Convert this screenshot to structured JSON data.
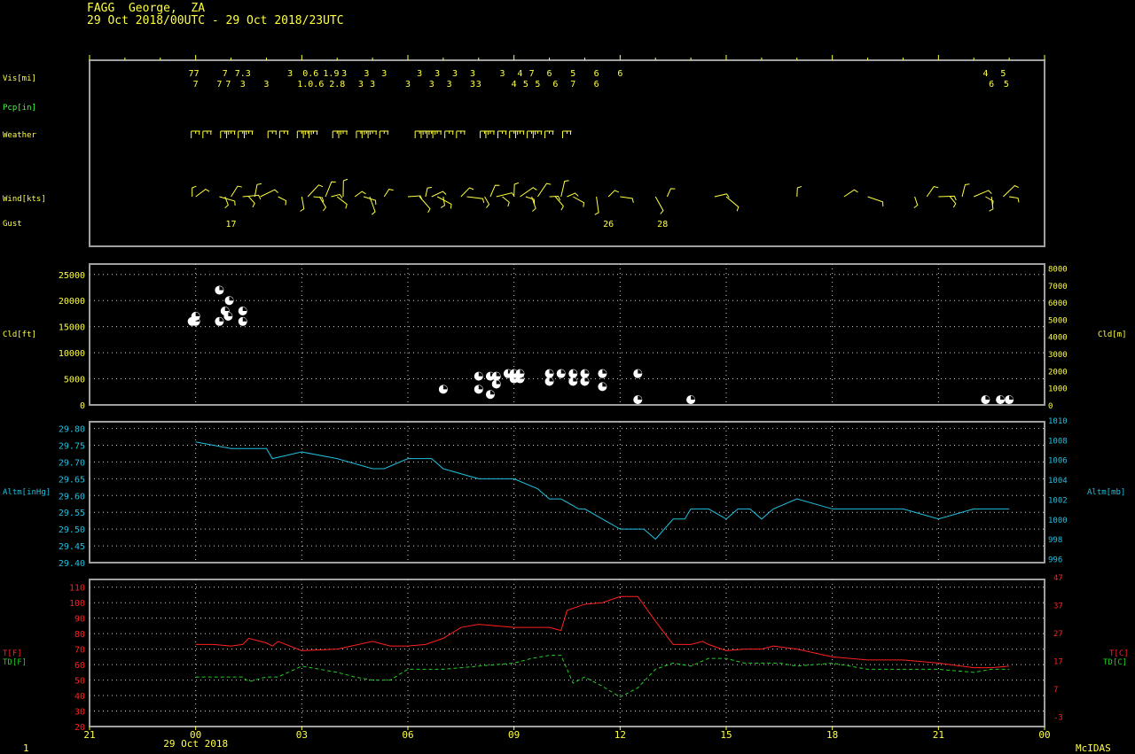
{
  "header": {
    "station_line": "FAGG  George,  ZA",
    "period_line": "29 Oct 2018/00UTC - 29 Oct 2018/23UTC"
  },
  "footer": {
    "left_label": "1",
    "brand": "McIDAS"
  },
  "colors": {
    "frame": "#a0a0a0",
    "labels": "#ffff40",
    "pcp": "#40ff40",
    "altimeter": "#20c0e0",
    "temp": "#ff2020",
    "dewpoint": "#20d020",
    "grid": "#d0d0d0"
  },
  "chart_data": [
    {
      "type": "table",
      "panel": "station-plot",
      "rows": [
        "Vis[mi]",
        "Pcp[in]",
        "Weather",
        "Wind[kts]",
        "Gust"
      ],
      "visibility": [
        {
          "t": -0.05,
          "v": "77",
          "level": 1
        },
        {
          "t": 0.0,
          "v": "7",
          "level": 2
        },
        {
          "t": 0.83,
          "v": "7",
          "level": 1
        },
        {
          "t": 0.67,
          "v": "7",
          "level": 2
        },
        {
          "t": 0.92,
          "v": "7",
          "level": 2
        },
        {
          "t": 1.33,
          "v": "7.3",
          "level": 1
        },
        {
          "t": 1.33,
          "v": "3",
          "level": 2
        },
        {
          "t": 2.0,
          "v": "3",
          "level": 2
        },
        {
          "t": 2.67,
          "v": "3",
          "level": 1
        },
        {
          "t": 3.25,
          "v": "0.6",
          "level": 1
        },
        {
          "t": 3.25,
          "v": "1.0.6",
          "level": 2
        },
        {
          "t": 3.83,
          "v": "1.9",
          "level": 1
        },
        {
          "t": 4.2,
          "v": "3",
          "level": 1
        },
        {
          "t": 4.0,
          "v": "2.8",
          "level": 2
        },
        {
          "t": 4.83,
          "v": "3",
          "level": 1
        },
        {
          "t": 5.33,
          "v": "3",
          "level": 1
        },
        {
          "t": 4.67,
          "v": "3",
          "level": 2
        },
        {
          "t": 5.0,
          "v": "3",
          "level": 2
        },
        {
          "t": 6.0,
          "v": "3",
          "level": 2
        },
        {
          "t": 6.33,
          "v": "3",
          "level": 1
        },
        {
          "t": 6.67,
          "v": "3",
          "level": 2
        },
        {
          "t": 6.83,
          "v": "3",
          "level": 1
        },
        {
          "t": 7.33,
          "v": "3",
          "level": 1
        },
        {
          "t": 7.17,
          "v": "3",
          "level": 2
        },
        {
          "t": 7.83,
          "v": "3",
          "level": 1
        },
        {
          "t": 7.83,
          "v": "3",
          "level": 2
        },
        {
          "t": 8.0,
          "v": "3",
          "level": 2
        },
        {
          "t": 8.67,
          "v": "3",
          "level": 1
        },
        {
          "t": 9.0,
          "v": "4",
          "level": 2
        },
        {
          "t": 9.17,
          "v": "4",
          "level": 1
        },
        {
          "t": 9.33,
          "v": "5",
          "level": 2
        },
        {
          "t": 9.5,
          "v": "7",
          "level": 1
        },
        {
          "t": 9.67,
          "v": "5",
          "level": 2
        },
        {
          "t": 10.0,
          "v": "6",
          "level": 1
        },
        {
          "t": 10.17,
          "v": "6",
          "level": 2
        },
        {
          "t": 10.67,
          "v": "5",
          "level": 1
        },
        {
          "t": 10.67,
          "v": "7",
          "level": 2
        },
        {
          "t": 11.33,
          "v": "6",
          "level": 1
        },
        {
          "t": 11.33,
          "v": "6",
          "level": 2
        },
        {
          "t": 12.0,
          "v": "6",
          "level": 1
        },
        {
          "t": 22.33,
          "v": "4",
          "level": 1
        },
        {
          "t": 22.5,
          "v": "6",
          "level": 2
        },
        {
          "t": 22.83,
          "v": "5",
          "level": 1
        },
        {
          "t": 22.92,
          "v": "5",
          "level": 2
        }
      ],
      "gust_kts": [
        {
          "t": 1.0,
          "v": "17"
        },
        {
          "t": 11.67,
          "v": "26"
        },
        {
          "t": 13.2,
          "v": "28"
        }
      ],
      "wind_barbs_t": [
        -0.1,
        0.0,
        0.67,
        0.83,
        1.0,
        1.33,
        1.5,
        1.67,
        1.83,
        2.33,
        3.0,
        3.17,
        3.33,
        3.5,
        3.67,
        3.83,
        4.0,
        4.17,
        4.5,
        4.75,
        4.92,
        5.33,
        6.0,
        6.33,
        6.5,
        6.67,
        6.83,
        7.0,
        7.5,
        7.67,
        8.17,
        8.33,
        8.5,
        8.67,
        9.0,
        9.17,
        9.33,
        9.5,
        9.67,
        10.0,
        10.17,
        10.33,
        10.5,
        10.67,
        11.33,
        11.67,
        12.0,
        13.0,
        13.33,
        14.67,
        15.0,
        17.0,
        18.33,
        19.0,
        20.33,
        20.67,
        21.0,
        21.33,
        21.67,
        22.0,
        22.33,
        22.5,
        22.83,
        23.0
      ],
      "weather_t": [
        0.0,
        0.33,
        0.83,
        1.0,
        1.33,
        1.5,
        2.17,
        2.5,
        3.0,
        3.17,
        3.33,
        4.0,
        4.17,
        4.67,
        4.83,
        5.0,
        5.33,
        6.33,
        6.5,
        6.67,
        6.83,
        7.17,
        7.5,
        8.17,
        8.33,
        8.67,
        9.0,
        9.17,
        9.5,
        9.67,
        10.0,
        10.5
      ]
    },
    {
      "type": "scatter",
      "panel": "cloud-base",
      "ylabel": "Cld[ft]",
      "ylabel_right": "Cld[m]",
      "ylim": [
        0,
        27000
      ],
      "y_ticks": [
        0,
        5000,
        10000,
        15000,
        20000,
        25000
      ],
      "y2_ticks": [
        0,
        1000,
        2000,
        3000,
        4000,
        5000,
        6000,
        7000,
        8000
      ],
      "points": [
        {
          "t": -0.1,
          "ft": 16000
        },
        {
          "t": 0.0,
          "ft": 16000
        },
        {
          "t": 0.0,
          "ft": 17000
        },
        {
          "t": 0.67,
          "ft": 22000
        },
        {
          "t": 0.67,
          "ft": 16000
        },
        {
          "t": 0.83,
          "ft": 18000
        },
        {
          "t": 0.92,
          "ft": 17000
        },
        {
          "t": 0.95,
          "ft": 20000
        },
        {
          "t": 1.33,
          "ft": 18000
        },
        {
          "t": 1.33,
          "ft": 16000
        },
        {
          "t": 7.0,
          "ft": 3000
        },
        {
          "t": 8.0,
          "ft": 5500
        },
        {
          "t": 8.0,
          "ft": 3000
        },
        {
          "t": 8.33,
          "ft": 5500
        },
        {
          "t": 8.33,
          "ft": 2000
        },
        {
          "t": 8.5,
          "ft": 4000
        },
        {
          "t": 8.5,
          "ft": 5500
        },
        {
          "t": 8.83,
          "ft": 6000
        },
        {
          "t": 9.0,
          "ft": 5000
        },
        {
          "t": 9.0,
          "ft": 6000
        },
        {
          "t": 9.17,
          "ft": 5000
        },
        {
          "t": 9.17,
          "ft": 6000
        },
        {
          "t": 10.0,
          "ft": 4500
        },
        {
          "t": 10.0,
          "ft": 6000
        },
        {
          "t": 10.33,
          "ft": 6000
        },
        {
          "t": 10.67,
          "ft": 4500
        },
        {
          "t": 10.67,
          "ft": 6000
        },
        {
          "t": 11.0,
          "ft": 4500
        },
        {
          "t": 11.0,
          "ft": 6000
        },
        {
          "t": 11.5,
          "ft": 3500
        },
        {
          "t": 11.5,
          "ft": 6000
        },
        {
          "t": 12.5,
          "ft": 6000
        },
        {
          "t": 12.5,
          "ft": 1000
        },
        {
          "t": 14.0,
          "ft": 1000
        },
        {
          "t": 22.33,
          "ft": 1000
        },
        {
          "t": 22.75,
          "ft": 1000
        },
        {
          "t": 23.0,
          "ft": 1000
        }
      ]
    },
    {
      "type": "line",
      "panel": "altimeter",
      "ylabel": "Altm[inHg]",
      "ylabel_right": "Altm[mb]",
      "ylim": [
        29.4,
        29.82
      ],
      "y_ticks": [
        "29.40",
        "29.45",
        "29.50",
        "29.55",
        "29.60",
        "29.65",
        "29.70",
        "29.75",
        "29.80"
      ],
      "y2_ticks": [
        "996",
        "998",
        "1000",
        "1002",
        "1004",
        "1006",
        "1008",
        "1010"
      ],
      "series": [
        {
          "color": "#20c0e0",
          "x": [
            0.0,
            1.0,
            2.0,
            2.17,
            3.0,
            4.0,
            5.0,
            5.33,
            6.0,
            6.67,
            7.0,
            8.0,
            9.0,
            9.67,
            10.0,
            10.33,
            10.83,
            11.0,
            11.5,
            12.0,
            12.67,
            13.0,
            13.5,
            13.83,
            14.0,
            14.5,
            15.0,
            15.33,
            15.67,
            16.0,
            16.33,
            17.0,
            18.0,
            19.0,
            20.0,
            21.0,
            22.0,
            23.0
          ],
          "y": [
            29.76,
            29.74,
            29.74,
            29.71,
            29.73,
            29.71,
            29.68,
            29.68,
            29.71,
            29.71,
            29.68,
            29.65,
            29.65,
            29.62,
            29.59,
            29.59,
            29.56,
            29.56,
            29.53,
            29.5,
            29.5,
            29.47,
            29.53,
            29.53,
            29.56,
            29.56,
            29.53,
            29.56,
            29.56,
            29.53,
            29.56,
            29.59,
            29.56,
            29.56,
            29.56,
            29.53,
            29.56,
            29.56
          ]
        }
      ]
    },
    {
      "type": "line",
      "panel": "temperature",
      "ylabel": "T[F]",
      "ylabel2": "TD[F]",
      "ylabel_right": "T[C]",
      "ylabel_right2": "TD[C]",
      "ylim": [
        20,
        115
      ],
      "y_ticks": [
        20,
        30,
        40,
        50,
        60,
        70,
        80,
        90,
        100,
        110
      ],
      "y2_ticks": [
        "-3",
        "7",
        "17",
        "27",
        "37",
        "47"
      ],
      "x_tick_labels": [
        "21",
        "00",
        "03",
        "06",
        "09",
        "12",
        "15",
        "18",
        "21",
        "00"
      ],
      "x_ticks_t": [
        -3,
        0,
        3,
        6,
        9,
        12,
        15,
        18,
        21,
        24
      ],
      "date_label": "29 Oct 2018",
      "series": [
        {
          "color": "#ff2020",
          "x": [
            0.0,
            0.5,
            1.0,
            1.33,
            1.5,
            2.0,
            2.17,
            2.33,
            3.0,
            4.0,
            5.0,
            5.5,
            6.0,
            6.5,
            7.0,
            7.5,
            8.0,
            9.0,
            10.0,
            10.33,
            10.5,
            11.0,
            11.5,
            12.0,
            12.5,
            13.0,
            13.5,
            14.0,
            14.33,
            14.5,
            15.0,
            15.5,
            16.0,
            16.33,
            17.0,
            18.0,
            19.0,
            20.0,
            21.0,
            22.0,
            22.5,
            23.0
          ],
          "y": [
            73,
            73,
            72,
            73,
            77,
            74,
            72,
            75,
            69,
            70,
            75,
            72,
            72,
            73,
            77,
            84,
            86,
            84,
            84,
            82,
            95,
            99,
            100,
            104,
            104,
            88,
            73,
            73,
            75,
            73,
            69,
            70,
            70,
            72,
            70,
            65,
            63,
            63,
            61,
            58,
            58,
            59
          ]
        },
        {
          "color": "#20d020",
          "x": [
            0.0,
            0.5,
            1.0,
            1.33,
            1.5,
            2.0,
            2.33,
            3.0,
            4.0,
            4.5,
            5.0,
            5.5,
            6.0,
            6.5,
            7.0,
            8.0,
            9.0,
            9.5,
            10.0,
            10.33,
            10.67,
            11.0,
            11.5,
            12.0,
            12.5,
            13.0,
            13.5,
            14.0,
            14.5,
            15.0,
            15.5,
            16.0,
            16.5,
            17.0,
            18.0,
            19.0,
            20.0,
            21.0,
            22.0,
            22.5,
            23.0
          ],
          "y": [
            52,
            52,
            52,
            52,
            49,
            52,
            52,
            59,
            55,
            52,
            50,
            50,
            57,
            57,
            57,
            59,
            61,
            64,
            66,
            66,
            48,
            52,
            46,
            39,
            45,
            57,
            61,
            59,
            64,
            64,
            61,
            61,
            61,
            59,
            61,
            57,
            57,
            57,
            55,
            57,
            57
          ]
        }
      ]
    }
  ]
}
